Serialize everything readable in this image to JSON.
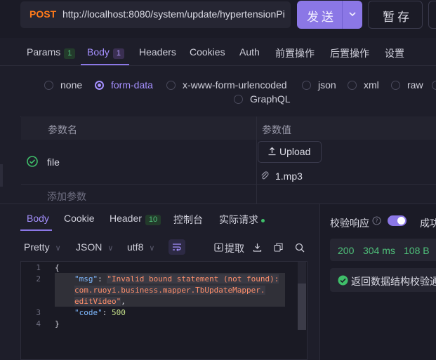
{
  "request": {
    "method": "POST",
    "url": "http://localhost:8080/system/update/hypertensionPi",
    "send_label": "发送",
    "save_label": "暂存"
  },
  "request_tabs": [
    {
      "label": "Params",
      "badge": "1"
    },
    {
      "label": "Body",
      "badge": "1"
    },
    {
      "label": "Headers"
    },
    {
      "label": "Cookies"
    },
    {
      "label": "Auth"
    },
    {
      "label": "前置操作"
    },
    {
      "label": "后置操作"
    },
    {
      "label": "设置"
    }
  ],
  "body_types": [
    "none",
    "form-data",
    "x-www-form-urlencoded",
    "json",
    "xml",
    "raw",
    "GraphQL"
  ],
  "body_type_selected": "form-data",
  "form_table": {
    "col_name": "参数名",
    "col_value": "参数值",
    "rows": [
      {
        "name": "file",
        "upload_label": "Upload",
        "file_name": "1.mp3"
      }
    ],
    "add_param": "添加参数"
  },
  "response_tabs": [
    {
      "label": "Body"
    },
    {
      "label": "Cookie"
    },
    {
      "label": "Header",
      "badge": "10"
    },
    {
      "label": "控制台"
    },
    {
      "label": "实际请求"
    }
  ],
  "response_toolbar": {
    "format": "Pretty",
    "language": "JSON",
    "encoding": "utf8",
    "extract": "提取"
  },
  "response_code": {
    "line_numbers": [
      "1",
      "2",
      "",
      "",
      "3",
      "4"
    ],
    "open_brace": "{",
    "msg_key": "\"msg\"",
    "msg_value_1": "\"Invalid bound statement (not found):",
    "msg_value_2": "com.ruoyi.business.mapper.TbUpdateMapper.",
    "msg_value_3": "editVideo\"",
    "code_key": "\"code\"",
    "code_value": "500",
    "close_brace": "}"
  },
  "validation": {
    "label": "校验响应",
    "right_cut": "成功",
    "status_code": "200",
    "time": "304 ms",
    "size": "108 B",
    "result": "返回数据结构校验通"
  },
  "colors": {
    "accent": "#8b77e6",
    "method": "#ff7a1a",
    "success": "#3fbf6a"
  }
}
